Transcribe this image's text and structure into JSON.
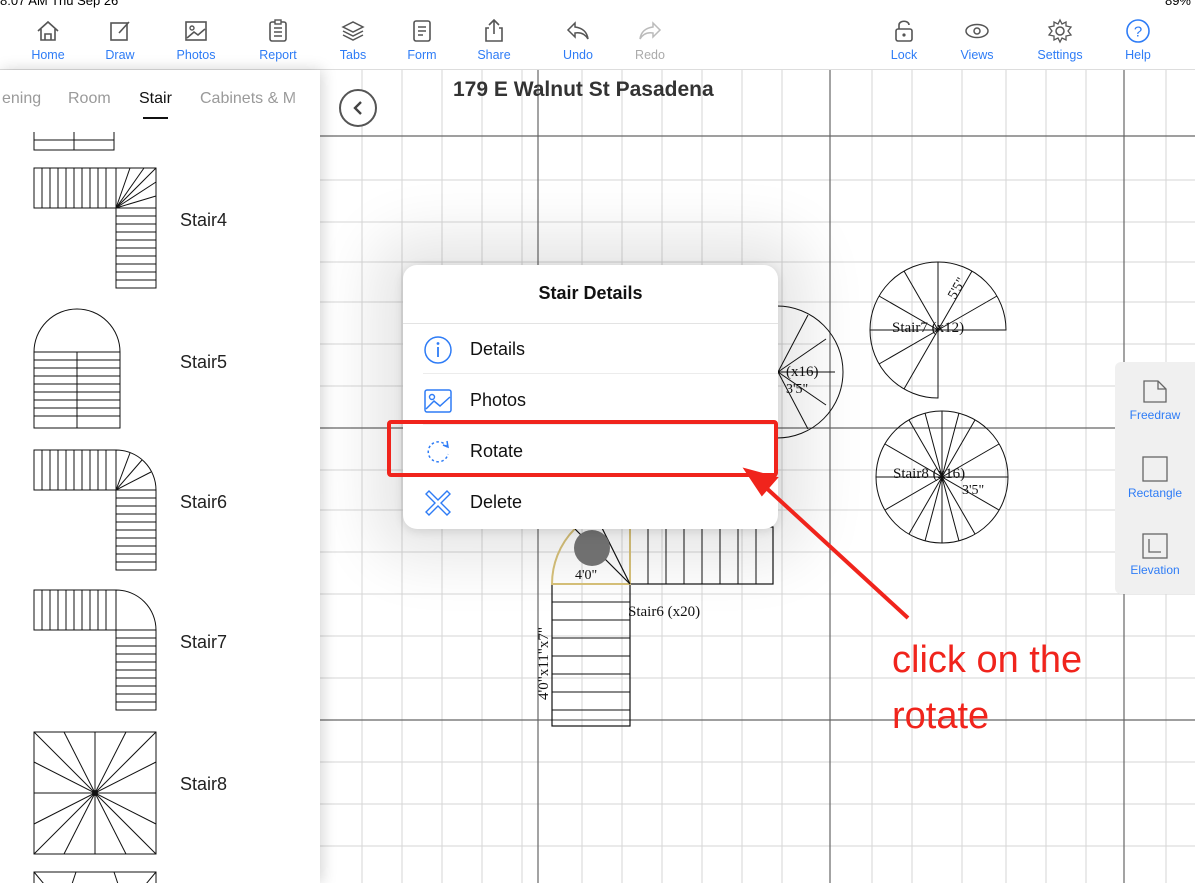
{
  "status_bar": {
    "time": "8:07 AM  Thu Sep 26",
    "battery": "89%"
  },
  "toolbar": {
    "items": [
      {
        "label": "Home",
        "icon": "home-icon"
      },
      {
        "label": "Draw",
        "icon": "draw-icon"
      },
      {
        "label": "Photos",
        "icon": "photos-icon"
      },
      {
        "label": "Report",
        "icon": "report-icon"
      },
      {
        "label": "Tabs",
        "icon": "tabs-icon"
      },
      {
        "label": "Form",
        "icon": "form-icon"
      },
      {
        "label": "Share",
        "icon": "share-icon"
      },
      {
        "label": "Undo",
        "icon": "undo-icon"
      },
      {
        "label": "Redo",
        "icon": "redo-icon"
      },
      {
        "label": "Lock",
        "icon": "lock-icon"
      },
      {
        "label": "Views",
        "icon": "views-icon"
      },
      {
        "label": "Settings",
        "icon": "gear-icon"
      },
      {
        "label": "Help",
        "icon": "help-icon"
      }
    ],
    "accent_color": "#2e7cf6",
    "disabled_color": "#aaaaaa"
  },
  "sidebar": {
    "tabs": [
      {
        "label": "ening"
      },
      {
        "label": "Room"
      },
      {
        "label": "Stair",
        "active": true
      },
      {
        "label": "Cabinets & M"
      }
    ],
    "items": [
      {
        "label": "Stair4"
      },
      {
        "label": "Stair5"
      },
      {
        "label": "Stair6"
      },
      {
        "label": "Stair7"
      },
      {
        "label": "Stair8"
      }
    ]
  },
  "canvas": {
    "address": "179 E Walnut St Pasadena",
    "labels": {
      "stair6": "Stair6 (x20)",
      "stair6_dim": "4'0\"x11\"x7\"",
      "stair6_width": "4'0\"",
      "spiral_a": "Stair7 (x12)",
      "spiral_b": "Stair8 (x16)",
      "spiral_c": "(x16)",
      "dim_35": "3'5\"",
      "dim_55": "5'5\""
    }
  },
  "right_panel": {
    "items": [
      {
        "label": "Freedraw",
        "icon": "freedraw-icon"
      },
      {
        "label": "Rectangle",
        "icon": "rectangle-icon"
      },
      {
        "label": "Elevation",
        "icon": "elevation-icon"
      }
    ]
  },
  "popup": {
    "title": "Stair Details",
    "items": [
      {
        "label": "Details",
        "icon": "info-icon"
      },
      {
        "label": "Photos",
        "icon": "photo-icon"
      },
      {
        "label": "Rotate",
        "icon": "rotate-icon"
      },
      {
        "label": "Delete",
        "icon": "delete-icon"
      }
    ]
  },
  "annotation": {
    "text": "click on the\nrotate",
    "color": "#f0241c"
  }
}
